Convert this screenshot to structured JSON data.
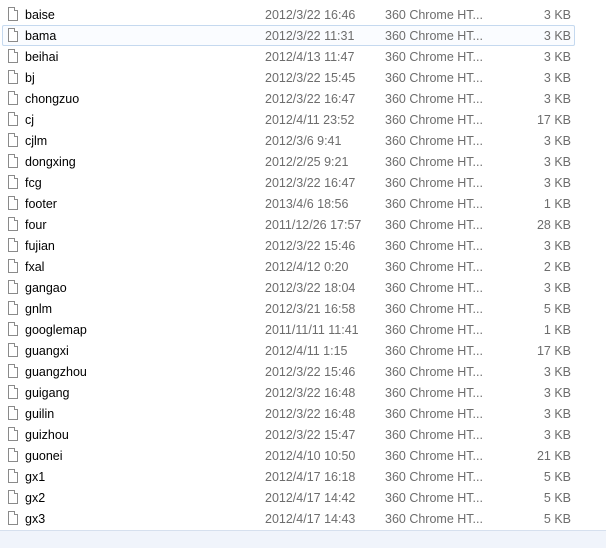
{
  "selected_index": 2,
  "files": [
    {
      "name": "",
      "date": "",
      "type": "",
      "size": ""
    },
    {
      "name": "baise",
      "date": "2012/3/22 16:46",
      "type": "360 Chrome HT...",
      "size": "3 KB"
    },
    {
      "name": "bama",
      "date": "2012/3/22 11:31",
      "type": "360 Chrome HT...",
      "size": "3 KB"
    },
    {
      "name": "beihai",
      "date": "2012/4/13 11:47",
      "type": "360 Chrome HT...",
      "size": "3 KB"
    },
    {
      "name": "bj",
      "date": "2012/3/22 15:45",
      "type": "360 Chrome HT...",
      "size": "3 KB"
    },
    {
      "name": "chongzuo",
      "date": "2012/3/22 16:47",
      "type": "360 Chrome HT...",
      "size": "3 KB"
    },
    {
      "name": "cj",
      "date": "2012/4/11 23:52",
      "type": "360 Chrome HT...",
      "size": "17 KB"
    },
    {
      "name": "cjlm",
      "date": "2012/3/6 9:41",
      "type": "360 Chrome HT...",
      "size": "3 KB"
    },
    {
      "name": "dongxing",
      "date": "2012/2/25 9:21",
      "type": "360 Chrome HT...",
      "size": "3 KB"
    },
    {
      "name": "fcg",
      "date": "2012/3/22 16:47",
      "type": "360 Chrome HT...",
      "size": "3 KB"
    },
    {
      "name": "footer",
      "date": "2013/4/6 18:56",
      "type": "360 Chrome HT...",
      "size": "1 KB"
    },
    {
      "name": "four",
      "date": "2011/12/26 17:57",
      "type": "360 Chrome HT...",
      "size": "28 KB"
    },
    {
      "name": "fujian",
      "date": "2012/3/22 15:46",
      "type": "360 Chrome HT...",
      "size": "3 KB"
    },
    {
      "name": "fxal",
      "date": "2012/4/12 0:20",
      "type": "360 Chrome HT...",
      "size": "2 KB"
    },
    {
      "name": "gangao",
      "date": "2012/3/22 18:04",
      "type": "360 Chrome HT...",
      "size": "3 KB"
    },
    {
      "name": "gnlm",
      "date": "2012/3/21 16:58",
      "type": "360 Chrome HT...",
      "size": "5 KB"
    },
    {
      "name": "googlemap",
      "date": "2011/11/11 11:41",
      "type": "360 Chrome HT...",
      "size": "1 KB"
    },
    {
      "name": "guangxi",
      "date": "2012/4/11 1:15",
      "type": "360 Chrome HT...",
      "size": "17 KB"
    },
    {
      "name": "guangzhou",
      "date": "2012/3/22 15:46",
      "type": "360 Chrome HT...",
      "size": "3 KB"
    },
    {
      "name": "guigang",
      "date": "2012/3/22 16:48",
      "type": "360 Chrome HT...",
      "size": "3 KB"
    },
    {
      "name": "guilin",
      "date": "2012/3/22 16:48",
      "type": "360 Chrome HT...",
      "size": "3 KB"
    },
    {
      "name": "guizhou",
      "date": "2012/3/22 15:47",
      "type": "360 Chrome HT...",
      "size": "3 KB"
    },
    {
      "name": "guonei",
      "date": "2012/4/10 10:50",
      "type": "360 Chrome HT...",
      "size": "21 KB"
    },
    {
      "name": "gx1",
      "date": "2012/4/17 16:18",
      "type": "360 Chrome HT...",
      "size": "5 KB"
    },
    {
      "name": "gx2",
      "date": "2012/4/17 14:42",
      "type": "360 Chrome HT...",
      "size": "5 KB"
    },
    {
      "name": "gx3",
      "date": "2012/4/17 14:43",
      "type": "360 Chrome HT...",
      "size": "5 KB"
    }
  ]
}
